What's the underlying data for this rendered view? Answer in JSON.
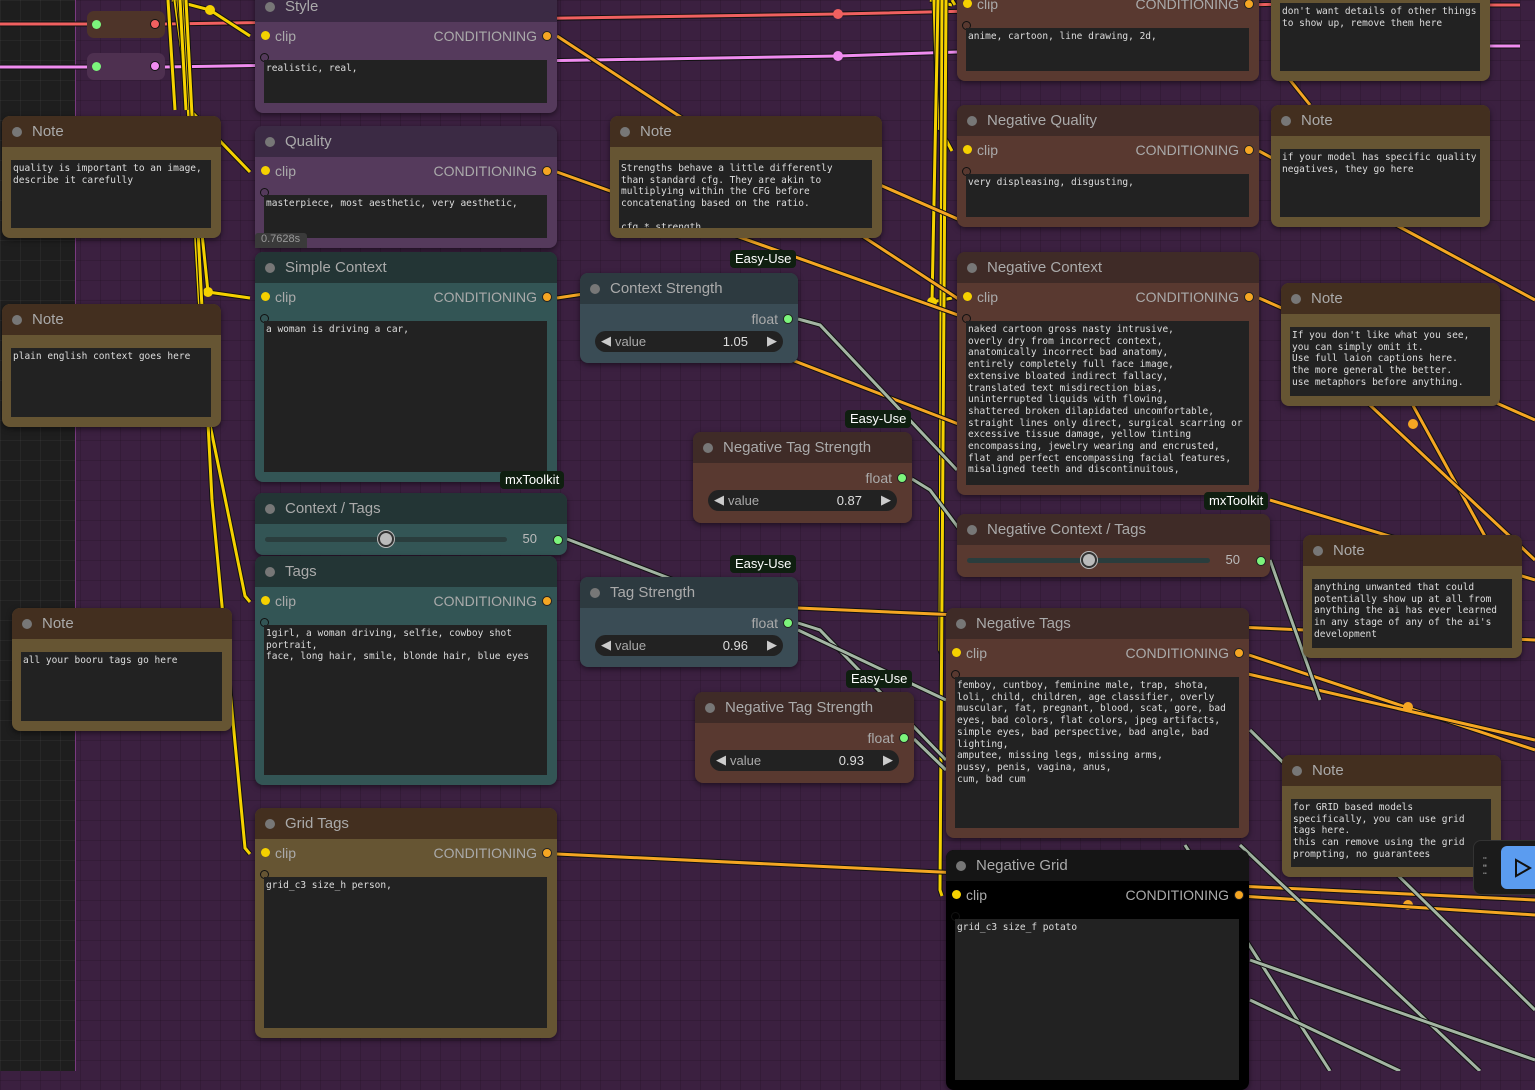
{
  "colors": {
    "canvas": "#3b2040",
    "clip_wire": "#f5d100",
    "conditioning_wire": "#f5a623",
    "float_wire": "#a3b5a3",
    "clip_red": "#f06060",
    "pink": "#f08cf0",
    "run_button": "#5b9cf0"
  },
  "timer_label": "0.7628s",
  "badges": [
    "Easy-Use",
    "Easy-Use",
    "Easy-Use",
    "Easy-Use",
    "mxToolkit",
    "mxToolkit"
  ],
  "nodes": [
    {
      "id": "style",
      "kind": "text",
      "theme": "purple",
      "title": "Style",
      "input": "clip",
      "output": "CONDITIONING",
      "text": "realistic, real,"
    },
    {
      "id": "quality",
      "kind": "text",
      "theme": "purple",
      "title": "Quality",
      "input": "clip",
      "output": "CONDITIONING",
      "text": "masterpiece, most aesthetic, very aesthetic,"
    },
    {
      "id": "simple-context",
      "kind": "text",
      "theme": "teal",
      "title": "Simple Context",
      "input": "clip",
      "output": "CONDITIONING",
      "text": "a woman is driving a car,"
    },
    {
      "id": "context-tags",
      "kind": "slider",
      "theme": "teal",
      "title": "Context / Tags",
      "value": 50
    },
    {
      "id": "tags",
      "kind": "text",
      "theme": "teal",
      "title": "Tags",
      "input": "clip",
      "output": "CONDITIONING",
      "text": "1girl, a woman driving, selfie, cowboy shot portrait,\nface, long hair, smile, blonde hair, blue eyes"
    },
    {
      "id": "grid-tags",
      "kind": "text",
      "theme": "note",
      "title": "Grid Tags",
      "input": "clip",
      "output": "CONDITIONING",
      "text": "grid_c3 size_h person,"
    },
    {
      "id": "note-quality",
      "kind": "note",
      "theme": "note",
      "title": "Note",
      "text": "quality is important to an image, describe it carefully"
    },
    {
      "id": "note-context",
      "kind": "note",
      "theme": "note",
      "title": "Note",
      "text": "plain english context goes here"
    },
    {
      "id": "note-tags",
      "kind": "note",
      "theme": "note",
      "title": "Note",
      "text": "all your booru tags go here"
    },
    {
      "id": "note-strength",
      "kind": "note",
      "theme": "note",
      "title": "Note",
      "text": "Strengths behave a little differently than standard cfg. They are akin to multiplying within the CFG before concatenating based on the ratio.\n\ncfg * strength",
      "scrollbar": true
    },
    {
      "id": "context-strength",
      "kind": "float",
      "theme": "slate",
      "title": "Context Strength",
      "output": "float",
      "label": "value",
      "value": "1.05"
    },
    {
      "id": "neg-tag-strength-1",
      "kind": "float",
      "theme": "brown",
      "title": "Negative Tag Strength",
      "output": "float",
      "label": "value",
      "value": "0.87"
    },
    {
      "id": "tag-strength",
      "kind": "float",
      "theme": "slate",
      "title": "Tag Strength",
      "output": "float",
      "label": "value",
      "value": "0.96"
    },
    {
      "id": "neg-tag-strength-2",
      "kind": "float",
      "theme": "brown",
      "title": "Negative Tag Strength",
      "output": "float",
      "label": "value",
      "value": "0.93"
    },
    {
      "id": "neg-style",
      "kind": "text",
      "theme": "brown",
      "title": "",
      "input": "clip",
      "output": "CONDITIONING",
      "text": "anime, cartoon, line drawing, 2d,"
    },
    {
      "id": "note-neg-style",
      "kind": "note",
      "theme": "note",
      "title": "",
      "text": "don't want details of other things to show up, remove them here"
    },
    {
      "id": "neg-quality",
      "kind": "text",
      "theme": "brown",
      "title": "Negative Quality",
      "input": "clip",
      "output": "CONDITIONING",
      "text": "very displeasing, disgusting,"
    },
    {
      "id": "note-neg-quality",
      "kind": "note",
      "theme": "note",
      "title": "Note",
      "text": "if your model has specific quality negatives, they go here"
    },
    {
      "id": "neg-context",
      "kind": "text",
      "theme": "brown",
      "title": "Negative Context",
      "input": "clip",
      "output": "CONDITIONING",
      "text": "naked cartoon gross nasty intrusive,\noverly dry from incorrect context,\nanatomically incorrect bad anatomy,\nentirely completely full face image,\nextensive bloated indirect fallacy,\ntranslated text misdirection bias,\nuninterrupted liquids with flowing,\nshattered broken dilapidated uncomfortable,\nstraight lines only direct, surgical scarring or\nexcessive tissue damage, yellow tinting\nencompassing, jewelry wearing and encrusted,\nflat and perfect encompassing facial features,\nmisaligned teeth and discontinuitous,"
    },
    {
      "id": "note-neg-context",
      "kind": "note",
      "theme": "note",
      "title": "Note",
      "text": "If you don't like what you see,\nyou can simply omit it.\nUse full laion captions here.\nthe more general the better.\nuse metaphors before anything."
    },
    {
      "id": "neg-context-tags",
      "kind": "slider",
      "theme": "brown",
      "title": "Negative Context / Tags",
      "value": 50
    },
    {
      "id": "note-neg-tags",
      "kind": "note",
      "theme": "note",
      "title": "Note",
      "text": "anything unwanted that could potentially show up at all from anything the ai has ever learned in any stage of any of the ai's development"
    },
    {
      "id": "neg-tags",
      "kind": "text",
      "theme": "brown",
      "title": "Negative Tags",
      "input": "clip",
      "output": "CONDITIONING",
      "text": "femboy, cuntboy, feminine male, trap, shota,\nloli, child, children, age classifier, overly\nmuscular, fat, pregnant, blood, scat, gore, bad\neyes, bad colors, flat colors, jpeg artifacts,\nsimple eyes, bad perspective, bad angle, bad\nlighting,\namputee, missing legs, missing arms,\npussy, penis, vagina, anus,\ncum, bad cum"
    },
    {
      "id": "note-neg-grid",
      "kind": "note",
      "theme": "note",
      "title": "Note",
      "text": "for GRID based models\nspecifically, you can use grid\ntags here.\nthis can remove using the grid\nprompting, no guarantees"
    },
    {
      "id": "neg-grid",
      "kind": "text",
      "theme": "black",
      "title": "Negative Grid",
      "input": "clip",
      "output": "CONDITIONING",
      "text": "grid_c3 size_f potato"
    }
  ],
  "run_panel": {
    "grip_icon": "drag-handle-icon",
    "play_icon": "play-icon"
  }
}
